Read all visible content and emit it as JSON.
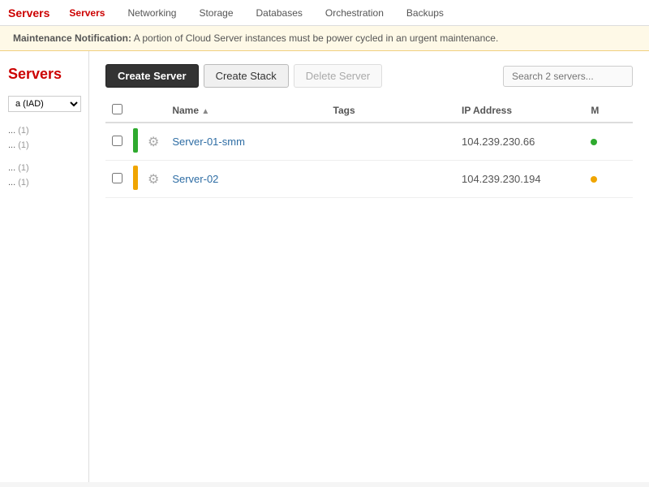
{
  "nav": {
    "logo": "Servers",
    "items": [
      {
        "label": "Servers",
        "active": true
      },
      {
        "label": "Networking",
        "active": false
      },
      {
        "label": "Storage",
        "active": false
      },
      {
        "label": "Databases",
        "active": false
      },
      {
        "label": "Orchestration",
        "active": false
      },
      {
        "label": "Backups",
        "active": false
      }
    ]
  },
  "notification": {
    "prefix": "Maintenance Notification:",
    "message": " A portion of Cloud Server instances must be power cycled in an urgent maintenance."
  },
  "sidebar": {
    "title": "Servers",
    "region": "a (IAD)",
    "groups": [
      {
        "label": "",
        "items": [
          {
            "text": "... (1)",
            "count": 1
          },
          {
            "text": "... (1)",
            "count": 1
          }
        ]
      },
      {
        "label": "",
        "items": [
          {
            "text": "... (1)",
            "count": 1
          },
          {
            "text": "... (1)",
            "count": 1
          }
        ]
      }
    ]
  },
  "toolbar": {
    "create_server_label": "Create Server",
    "create_stack_label": "Create Stack",
    "delete_server_label": "Delete Server",
    "search_placeholder": "Search 2 servers..."
  },
  "table": {
    "columns": [
      {
        "key": "check",
        "label": ""
      },
      {
        "key": "status",
        "label": ""
      },
      {
        "key": "gear",
        "label": ""
      },
      {
        "key": "name",
        "label": "Name"
      },
      {
        "key": "tags",
        "label": "Tags"
      },
      {
        "key": "ip",
        "label": "IP Address"
      },
      {
        "key": "monitoring",
        "label": "M"
      }
    ],
    "rows": [
      {
        "id": 1,
        "status_color": "green",
        "name": "Server-01-smm",
        "tags": "",
        "ip": "104.239.230.66",
        "monitoring_color": "green"
      },
      {
        "id": 2,
        "status_color": "orange",
        "name": "Server-02",
        "tags": "",
        "ip": "104.239.230.194",
        "monitoring_color": "orange"
      }
    ]
  }
}
